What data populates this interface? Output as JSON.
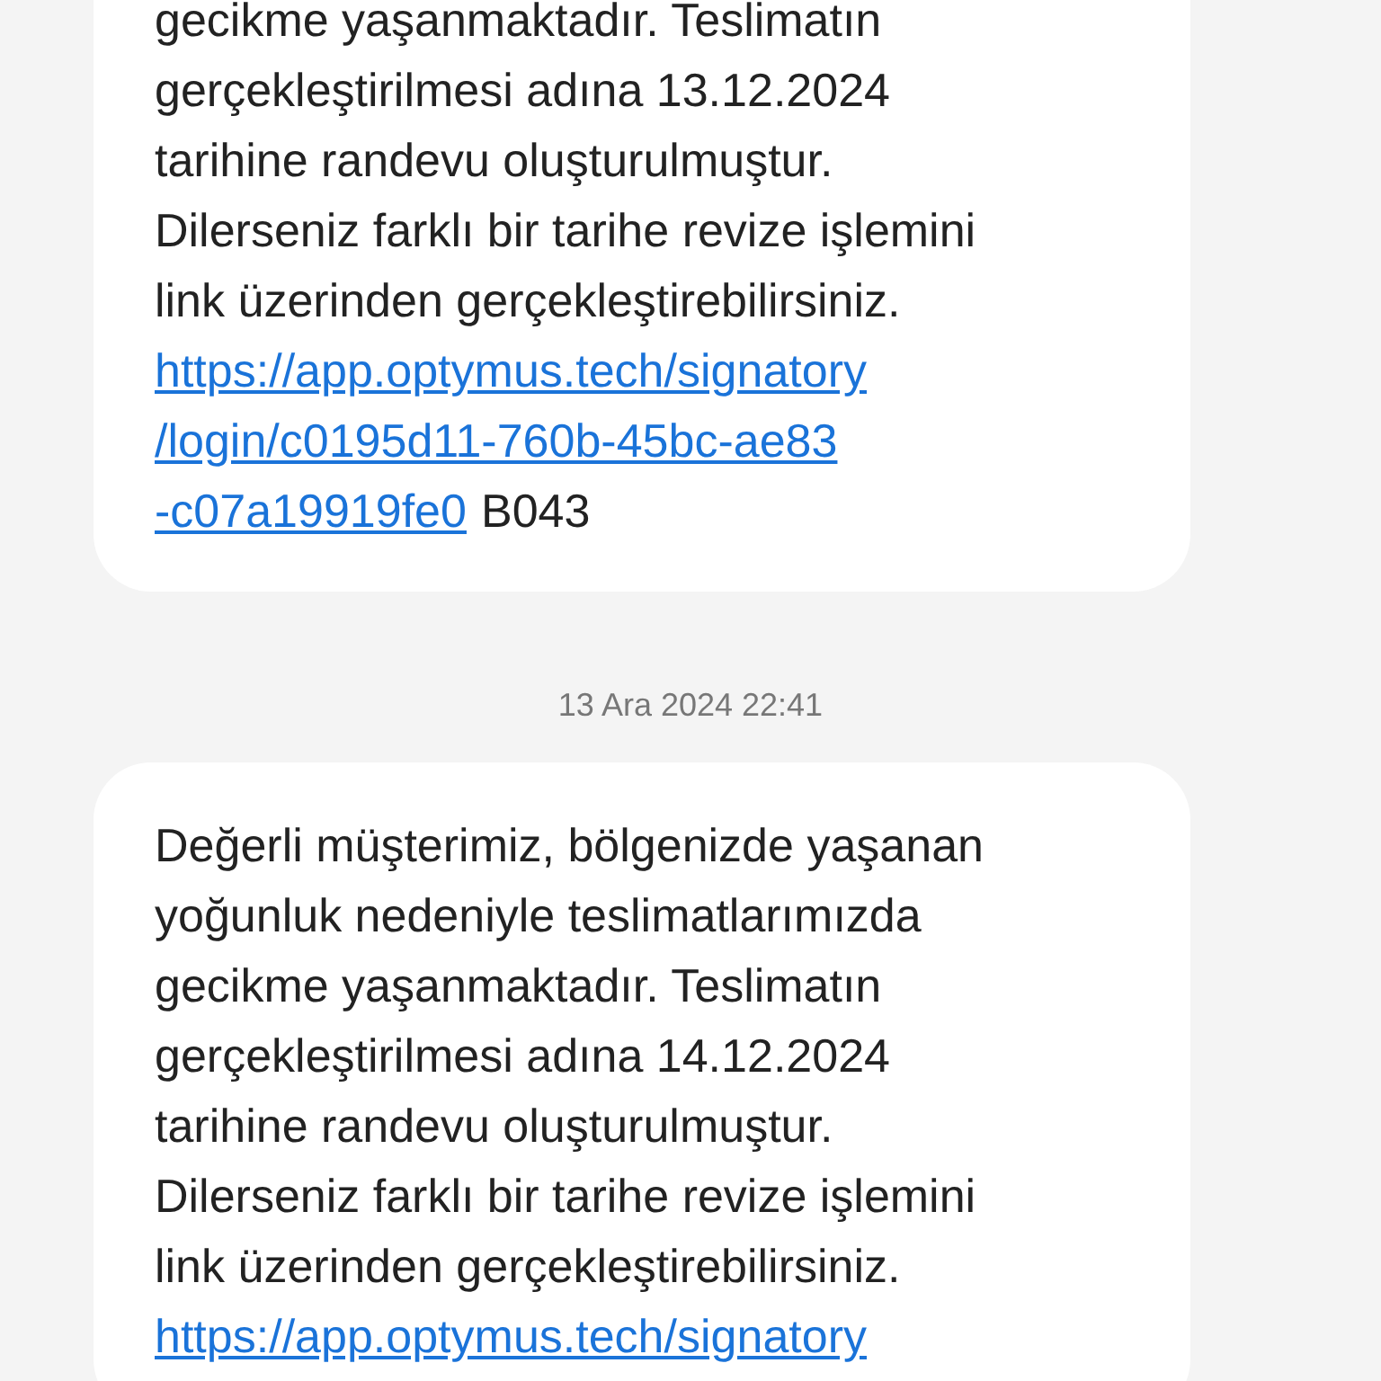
{
  "messages": [
    {
      "text_lines": [
        "gecikme yaşanmaktadır. Teslimatın",
        "gerçekleştirilmesi adına 13.12.2024",
        "tarihine randevu oluşturulmuştur.",
        "Dilerseniz farklı bir tarihe revize işlemini",
        "link üzerinden gerçekleştirebilirsiniz."
      ],
      "link_lines": [
        "https://app.optymus.tech/signatory",
        "/login/c0195d11-760b-45bc-ae83",
        "-c07a19919fe0"
      ],
      "suffix": "B043"
    },
    {
      "timestamp": "13 Ara 2024 22:41",
      "text_lines": [
        "Değerli müşterimiz, bölgenizde yaşanan",
        "yoğunluk nedeniyle teslimatlarımızda",
        "gecikme yaşanmaktadır. Teslimatın",
        "gerçekleştirilmesi adına 14.12.2024",
        "tarihine randevu oluşturulmuştur.",
        "Dilerseniz farklı bir tarihe revize işlemini",
        "link üzerinden gerçekleştirebilirsiniz."
      ],
      "link_lines": [
        "https://app.optymus.tech/signatory"
      ]
    }
  ]
}
